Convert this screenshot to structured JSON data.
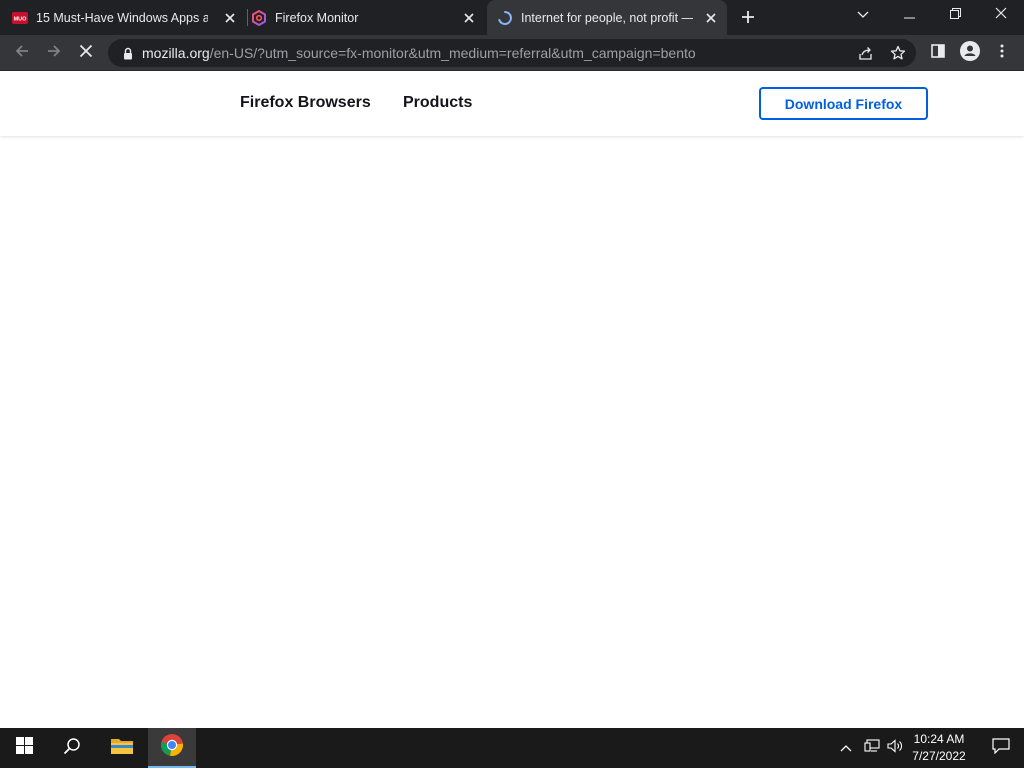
{
  "browser": {
    "tabs": [
      {
        "title": "15 Must-Have Windows Apps an",
        "favicon": "muo-icon"
      },
      {
        "title": "Firefox Monitor",
        "favicon": "firefox-monitor-icon"
      },
      {
        "title": "Internet for people, not profit —",
        "favicon": "loading-spinner-icon",
        "active": true
      }
    ],
    "url_host": "mozilla.org",
    "url_path": "/en-US/?utm_source=fx-monitor&utm_medium=referral&utm_campaign=bento"
  },
  "site": {
    "nav": [
      "Firefox Browsers",
      "Products"
    ],
    "download_label": "Download Firefox",
    "accent": "#0060df"
  },
  "taskbar": {
    "time": "10:24 AM",
    "date": "7/27/2022"
  }
}
